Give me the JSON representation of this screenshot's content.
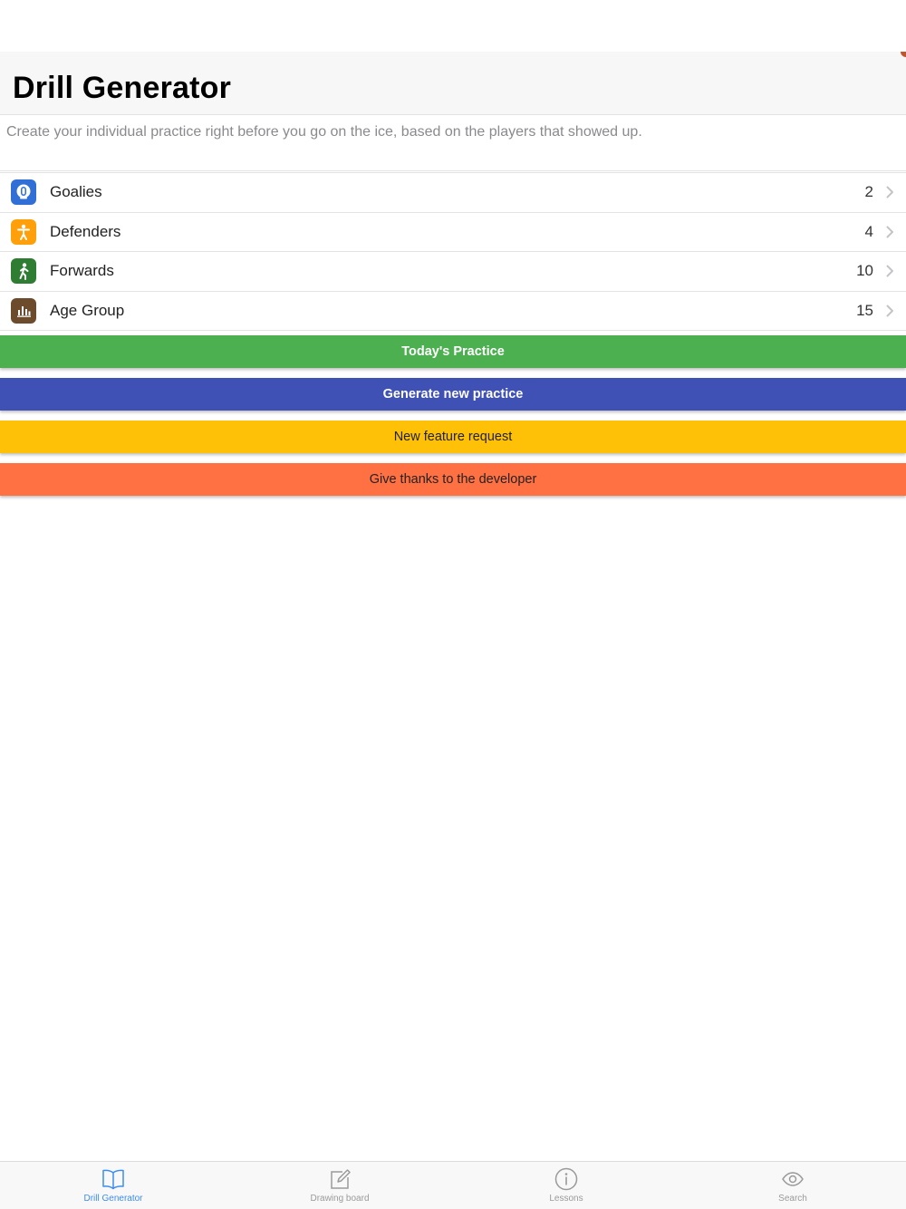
{
  "nav": {
    "title": "Drill Generator"
  },
  "intro": {
    "text": "Create your individual practice right before you go on the ice, based on the players that showed up."
  },
  "rows": [
    {
      "label": "Goalies",
      "value": "2",
      "icon": "goalie-icon",
      "color": "#2f6fd6"
    },
    {
      "label": "Defenders",
      "value": "4",
      "icon": "defender-icon",
      "color": "#ff9f0a"
    },
    {
      "label": "Forwards",
      "value": "10",
      "icon": "forward-icon",
      "color": "#2e7d32"
    },
    {
      "label": "Age Group",
      "value": "15",
      "icon": "age-chart-icon",
      "color": "#6d4c2e"
    }
  ],
  "buttons": {
    "todays_practice": "Today's Practice",
    "generate": "Generate new practice",
    "feature_request": "New feature request",
    "thanks": "Give thanks to the developer"
  },
  "button_colors": {
    "green": "#4caf50",
    "indigo": "#3f51b5",
    "amber": "#ffc107",
    "orange": "#ff7043"
  },
  "tabs": [
    {
      "label": "Drill Generator",
      "icon": "book-icon",
      "active": true
    },
    {
      "label": "Drawing board",
      "icon": "compose-icon",
      "active": false
    },
    {
      "label": "Lessons",
      "icon": "info-icon",
      "active": false
    },
    {
      "label": "Search",
      "icon": "eye-icon",
      "active": false
    }
  ],
  "colors": {
    "active_tab": "#3b8df0",
    "inactive_tab": "#9a9a9a"
  }
}
